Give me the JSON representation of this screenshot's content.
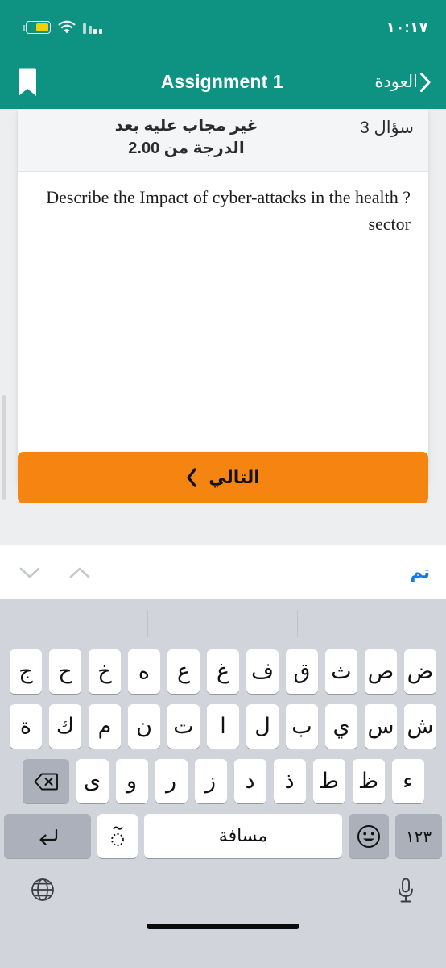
{
  "status_bar": {
    "time": "١٠:١٧",
    "battery_icon": "battery-icon",
    "wifi_icon": "wifi-icon",
    "signal_icon": "signal-bars-icon"
  },
  "nav_bar": {
    "back_label": "العودة",
    "title": "Assignment 1",
    "bookmark_icon": "bookmark-icon",
    "accent_color": "#0E9383"
  },
  "question": {
    "number_label": "سؤال 3",
    "status_label": "غير مجاب عليه بعد",
    "grade_label": "الدرجة من 2.00",
    "text": "Describe the Impact of cyber-attacks in the health sector?",
    "text_display": "Describe the Impact of cyber-attacks in the health\n?sector"
  },
  "next_button": {
    "label": "التالي",
    "color": "#F58410",
    "chevron_icon": "chevron-left-icon"
  },
  "keyboard_accessory": {
    "done_label": "تم",
    "done_color": "#1479EA",
    "prev_icon": "chevron-down-icon",
    "next_icon": "chevron-up-icon"
  },
  "keyboard": {
    "language": "arabic",
    "predictive_suggestions": [
      "",
      "",
      ""
    ],
    "row1": [
      "ض",
      "ص",
      "ث",
      "ق",
      "ف",
      "غ",
      "ع",
      "ه",
      "خ",
      "ح",
      "ج"
    ],
    "row2": [
      "ش",
      "س",
      "ي",
      "ب",
      "ل",
      "ا",
      "ت",
      "ن",
      "م",
      "ك",
      "ة"
    ],
    "row3": [
      "ء",
      "ظ",
      "ط",
      "ذ",
      "د",
      "ز",
      "ر",
      "و",
      "ى"
    ],
    "backspace_icon": "backspace-icon",
    "numbers_key_label": "١٢٣",
    "emoji_key_icon": "emoji-smiley-icon",
    "space_key_label": "مسافة",
    "diacritic_key_icon": "diacritic-key-icon",
    "enter_key_icon": "return-key-icon",
    "globe_icon": "globe-icon",
    "mic_icon": "microphone-icon",
    "bg_color": "#D1D4DA",
    "key_color": "#FFFFFF",
    "dark_key_color": "#ABB0BA"
  }
}
